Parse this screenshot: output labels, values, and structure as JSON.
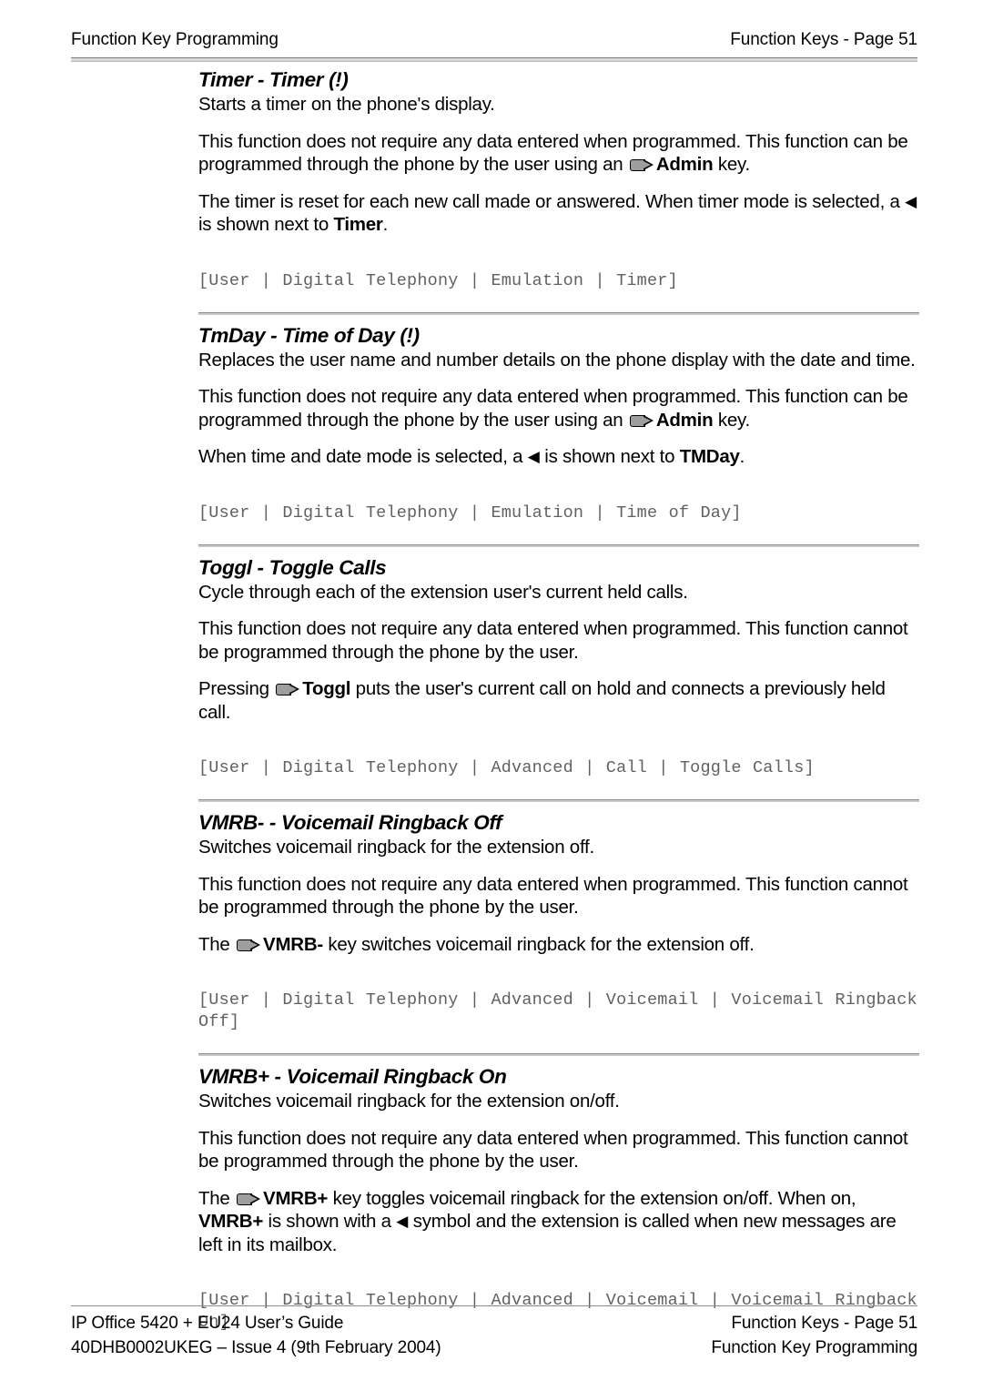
{
  "header": {
    "left": "Function Key Programming",
    "right": "Function Keys - Page 51"
  },
  "icons": {
    "phone_key": "phone-key-icon",
    "left_triangle": "◀"
  },
  "sections": [
    {
      "id": "timer",
      "heading": "Timer - Timer (!)",
      "p1": "Starts a timer on the phone's display.",
      "p2_a": "This function does not require any data entered when programmed. This function can be programmed through the phone by the user using an ",
      "p2_b": "Admin",
      "p2_c": " key.",
      "p3_a": "The timer is reset for each new call made or answered. When timer mode is selected, a ",
      "p3_b": " is shown next to ",
      "p3_c": "Timer",
      "p3_d": ".",
      "code": "[User | Digital Telephony | Emulation | Timer]"
    },
    {
      "id": "tmday",
      "heading": "TmDay - Time of Day (!)",
      "p1": "Replaces the user name and number details on the phone display with the date and time.",
      "p2_a": "This function does not require any data entered when programmed. This function can be programmed through the phone by the user using an ",
      "p2_b": "Admin",
      "p2_c": " key.",
      "p3_a": "When time and date mode is selected, a ",
      "p3_b": " is shown next to ",
      "p3_c": "TMDay",
      "p3_d": ".",
      "code": "[User | Digital Telephony | Emulation | Time of Day]"
    },
    {
      "id": "toggl",
      "heading": "Toggl - Toggle Calls",
      "p1": "Cycle through each of the extension user's current held calls.",
      "p2": "This function does not require any data entered when programmed. This function cannot be programmed through the phone by the user.",
      "p3_a": "Pressing ",
      "p3_b": "Toggl",
      "p3_c": " puts the user's current call on hold and connects a previously held call.",
      "code": "[User | Digital Telephony | Advanced | Call | Toggle Calls]"
    },
    {
      "id": "vmrb-off",
      "heading": "VMRB- - Voicemail Ringback Off",
      "p1": "Switches voicemail ringback for the extension off.",
      "p2": "This function does not require any data entered when programmed. This function cannot be programmed through the phone by the user.",
      "p3_a": "The ",
      "p3_b": "VMRB-",
      "p3_c": " key switches voicemail ringback for the extension off.",
      "code": "[User | Digital Telephony | Advanced | Voicemail | Voicemail Ringback Off]"
    },
    {
      "id": "vmrb-on",
      "heading": "VMRB+ - Voicemail Ringback On",
      "p1": "Switches voicemail ringback for the extension on/off.",
      "p2": "This function does not require any data entered when programmed. This function cannot be programmed through the phone by the user.",
      "p3_a": "The ",
      "p3_b": "VMRB+",
      "p3_c": " key toggles voicemail ringback for the extension on/off. When on, ",
      "p3_d": "VMRB+",
      "p3_e": " is shown with a ",
      "p3_f": " symbol and the extension is called when new messages are left in its mailbox.",
      "code": "[User | Digital Telephony | Advanced | Voicemail | Voicemail Ringback On]"
    }
  ],
  "footer": {
    "left_line1": "IP Office 5420 + EU24 User’s Guide",
    "left_line2": "40DHB0002UKEG – Issue 4 (9th February 2004)",
    "right_line1": "Function Keys - Page 51",
    "right_line2": "Function Key Programming"
  }
}
